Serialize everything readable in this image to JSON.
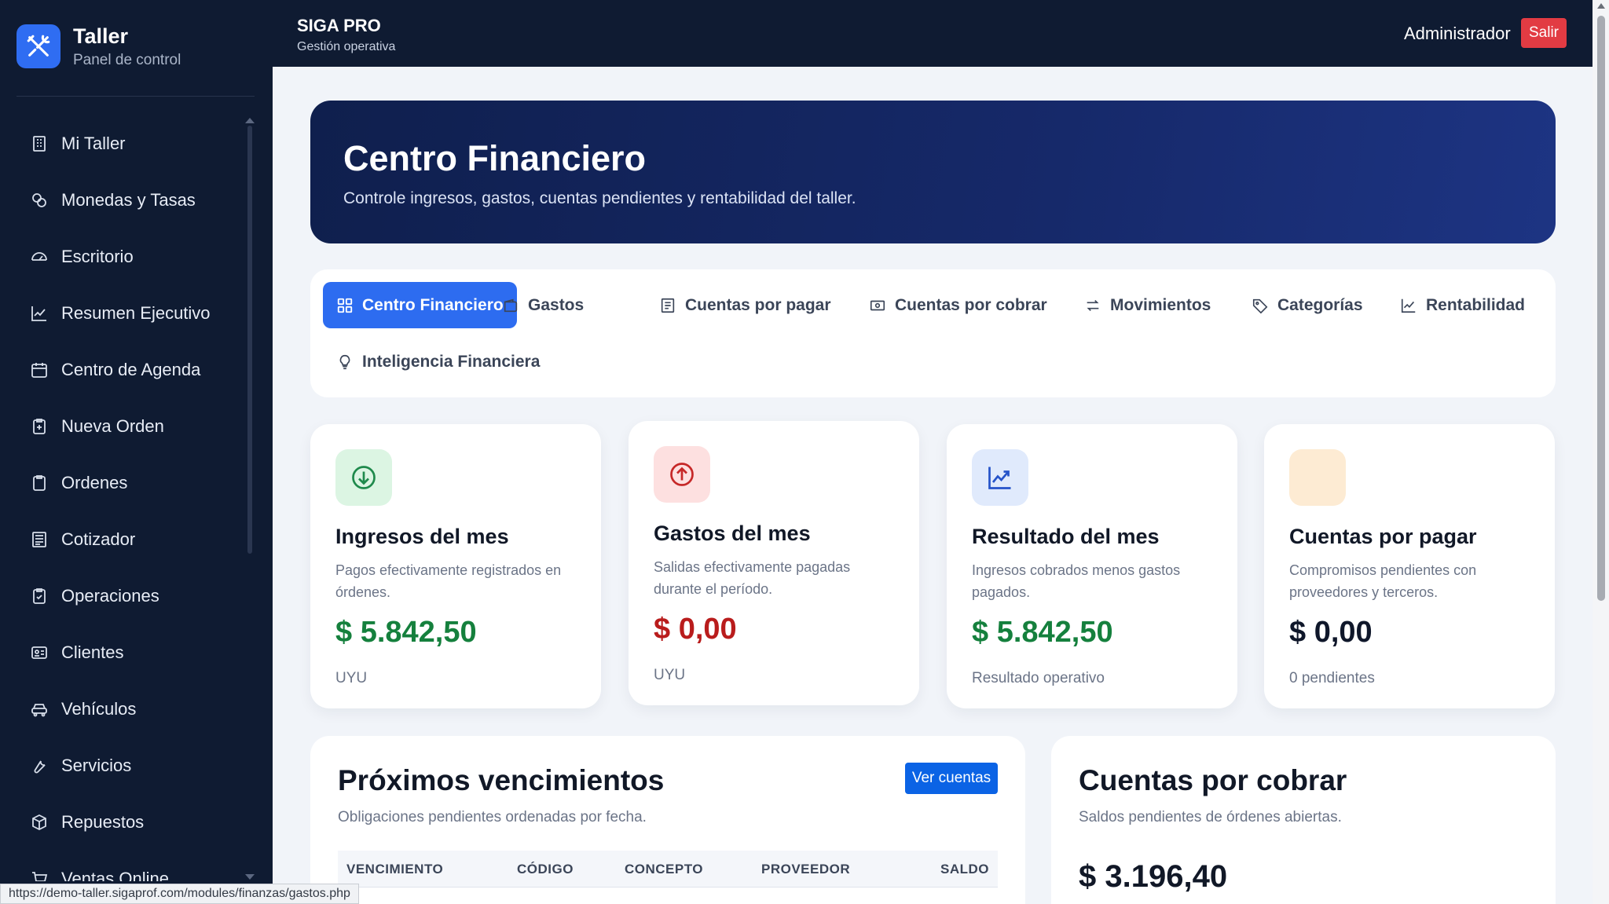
{
  "sidebar": {
    "brand": {
      "title": "Taller",
      "subtitle": "Panel de control",
      "logo_icon": "tools-icon"
    },
    "items": [
      {
        "label": "Mi Taller",
        "icon": "building-icon"
      },
      {
        "label": "Monedas y Tasas",
        "icon": "coins-icon"
      },
      {
        "label": "Escritorio",
        "icon": "gauge-icon"
      },
      {
        "label": "Resumen Ejecutivo",
        "icon": "line-chart-icon"
      },
      {
        "label": "Centro de Agenda",
        "icon": "calendar-icon"
      },
      {
        "label": "Nueva Orden",
        "icon": "clipboard-plus-icon"
      },
      {
        "label": "Ordenes",
        "icon": "clipboard-icon"
      },
      {
        "label": "Cotizador",
        "icon": "calculator-icon"
      },
      {
        "label": "Operaciones",
        "icon": "clipboard-check-icon"
      },
      {
        "label": "Clientes",
        "icon": "id-card-icon"
      },
      {
        "label": "Vehículos",
        "icon": "car-icon"
      },
      {
        "label": "Servicios",
        "icon": "wrench-icon"
      },
      {
        "label": "Repuestos",
        "icon": "box-icon"
      },
      {
        "label": "Ventas Online",
        "icon": "cart-icon"
      }
    ]
  },
  "topbar": {
    "app_title": "SIGA PRO",
    "app_subtitle": "Gestión operativa",
    "user": "Administrador",
    "logout_label": "Salir"
  },
  "hero": {
    "title": "Centro Financiero",
    "subtitle": "Controle ingresos, gastos, cuentas pendientes y rentabilidad del taller."
  },
  "tabs": [
    {
      "label": "Centro Financiero",
      "icon": "grid-icon",
      "active": true
    },
    {
      "label": "Gastos",
      "icon": "wallet-icon",
      "active": false
    },
    {
      "label": "Cuentas por pagar",
      "icon": "receipt-icon",
      "active": false
    },
    {
      "label": "Cuentas por cobrar",
      "icon": "cash-icon",
      "active": false
    },
    {
      "label": "Movimientos",
      "icon": "arrows-icon",
      "active": false
    },
    {
      "label": "Categorías",
      "icon": "tag-icon",
      "active": false
    },
    {
      "label": "Rentabilidad",
      "icon": "line-chart-icon",
      "active": false
    },
    {
      "label": "Inteligencia Financiera",
      "icon": "lightbulb-icon",
      "active": false
    }
  ],
  "kpis": [
    {
      "title": "Ingresos del mes",
      "description": "Pagos efectivamente registrados en órdenes.",
      "value": "$ 5.842,50",
      "footer": "UYU",
      "value_color": "#15803d",
      "icon": "arrow-down-circle-icon",
      "icon_bg": "#dcf5e3",
      "icon_color": "#1f8a4c"
    },
    {
      "title": "Gastos del mes",
      "description": "Salidas efectivamente pagadas durante el período.",
      "value": "$ 0,00",
      "footer": "UYU",
      "value_color": "#b91c1c",
      "icon": "arrow-up-circle-icon",
      "icon_bg": "#fde0e0",
      "icon_color": "#c62828"
    },
    {
      "title": "Resultado del mes",
      "description": "Ingresos cobrados menos gastos pagados.",
      "value": "$ 5.842,50",
      "footer": "Resultado operativo",
      "value_color": "#15803d",
      "icon": "trend-up-icon",
      "icon_bg": "#e0eafc",
      "icon_color": "#2553c9"
    },
    {
      "title": "Cuentas por pagar",
      "description": "Compromisos pendientes con proveedores y terceros.",
      "value": "$ 0,00",
      "footer": "0 pendientes",
      "value_color": "#0f172a",
      "icon": "blank-icon",
      "icon_bg": "#fdebd3",
      "icon_color": "#d97706"
    }
  ],
  "upcoming": {
    "title": "Próximos vencimientos",
    "subtitle": "Obligaciones pendientes ordenadas por fecha.",
    "button_label": "Ver cuentas",
    "columns": [
      "VENCIMIENTO",
      "CÓDIGO",
      "CONCEPTO",
      "PROVEEDOR",
      "SALDO"
    ]
  },
  "receivables": {
    "title": "Cuentas por cobrar",
    "subtitle": "Saldos pendientes de órdenes abiertas.",
    "amount": "$ 3.196,40"
  },
  "statusbar": {
    "url": "https://demo-taller.sigaprof.com/modules/finanzas/gastos.php"
  },
  "colors": {
    "sidebar_bg": "#0f1b32",
    "accent": "#2d6cf0",
    "danger": "#e23b43",
    "hero_start": "#0f1f4d",
    "hero_end": "#1d3483"
  }
}
